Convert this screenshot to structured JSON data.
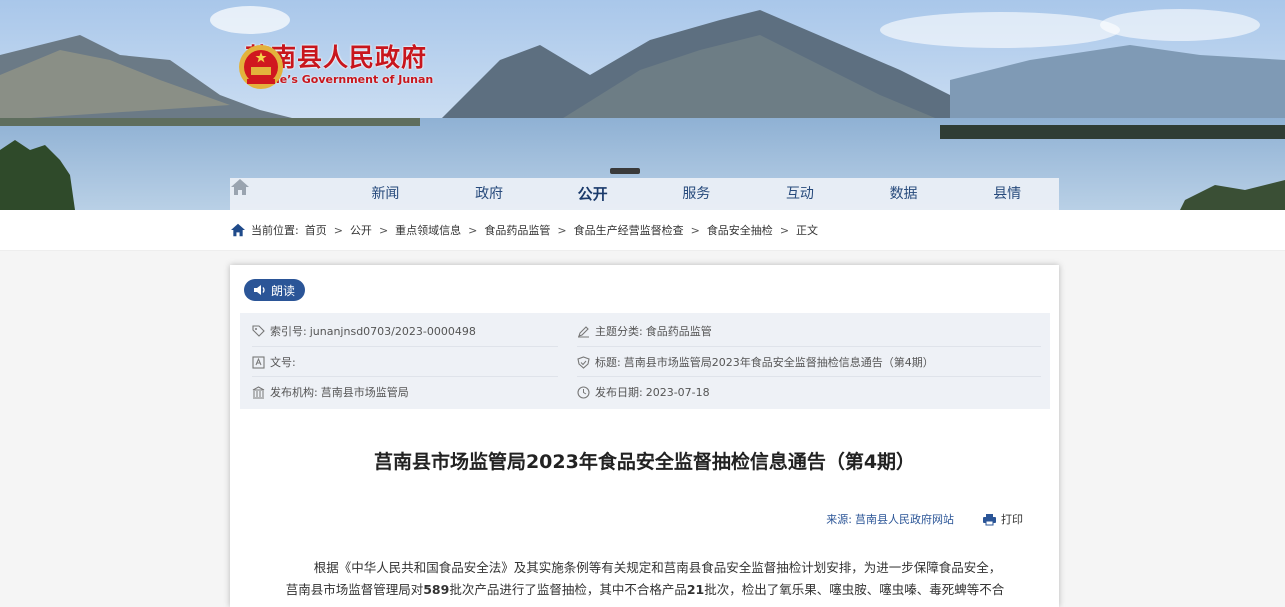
{
  "site": {
    "name_cn": "莒南县人民政府",
    "name_en": "People’s Government of Junan"
  },
  "nav": {
    "items": [
      "新闻",
      "政府",
      "公开",
      "服务",
      "互动",
      "数据",
      "县情"
    ],
    "active": "公开"
  },
  "breadcrumb": {
    "label": "当前位置:",
    "items": [
      "首页",
      "公开",
      "重点领域信息",
      "食品药品监管",
      "食品生产经营监督检查",
      "食品安全抽检",
      "正文"
    ]
  },
  "read_button": "朗读",
  "meta": {
    "index_label": "索引号:",
    "index_value": "junanjnsd0703/2023-0000498",
    "topic_label": "主题分类:",
    "topic_value": "食品药品监管",
    "doc_label": "文号:",
    "doc_value": "",
    "title_label": "标题:",
    "title_value": "莒南县市场监管局2023年食品安全监督抽检信息通告（第4期）",
    "org_label": "发布机构:",
    "org_value": "莒南县市场监管局",
    "date_label": "发布日期:",
    "date_value": "2023-07-18"
  },
  "article": {
    "title": "莒南县市场监管局2023年食品安全监督抽检信息通告（第4期）",
    "source_label": "来源:",
    "source_value": "莒南县人民政府网站",
    "print_label": "打印",
    "p1_a": "根据《中华人民共和国食品安全法》及其实施条例等有关规定和莒南县食品安全监督抽检计划安排，为进一步保障食品安全，",
    "p1_b1": "莒南县市场监督管理局对",
    "p1_b2": "589",
    "p1_b3": "批次产品进行了监督抽检，其中不合格产品",
    "p1_b4": "21",
    "p1_b5": "批次，检出了氧乐果、噻虫胺、噻虫嗪、毒死蜱等不合"
  },
  "colors": {
    "accent": "#2b5597",
    "brand_red": "#c8161d"
  }
}
